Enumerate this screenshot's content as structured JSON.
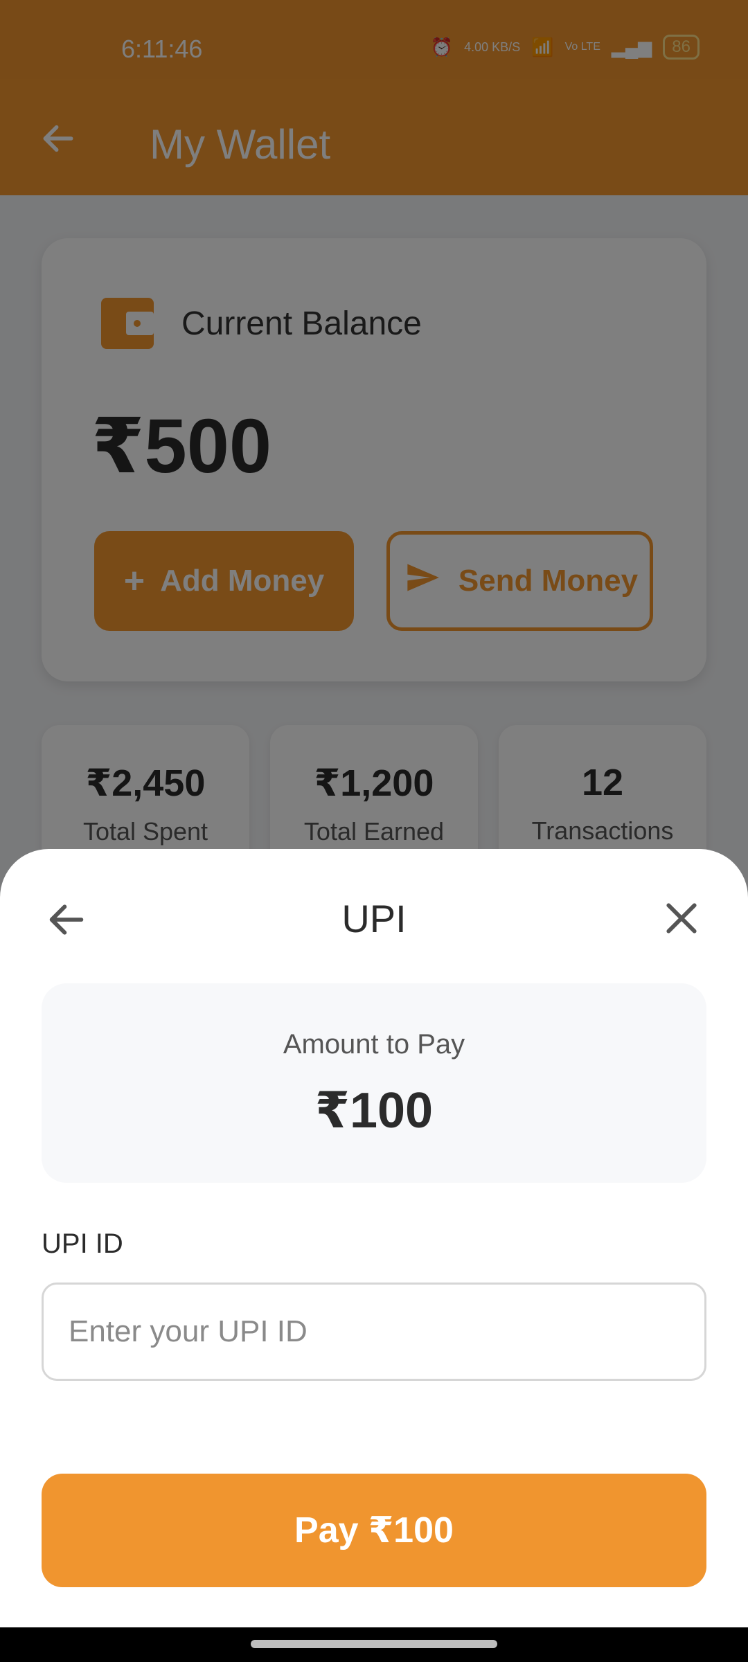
{
  "status_bar": {
    "time": "6:11:46",
    "network_speed": "4.00 KB/S",
    "volte_label": "Vo LTE",
    "battery": "86"
  },
  "app_bar": {
    "title": "My Wallet",
    "back_icon": "arrow-left-icon"
  },
  "balance_card": {
    "label": "Current Balance",
    "amount": "₹500",
    "add_money_label": "Add Money",
    "send_money_label": "Send Money"
  },
  "stats": [
    {
      "value": "₹2,450",
      "label": "Total Spent"
    },
    {
      "value": "₹1,200",
      "label": "Total Earned"
    },
    {
      "value": "12",
      "label": "Transactions"
    }
  ],
  "sheet": {
    "title": "UPI",
    "amount_label": "Amount to Pay",
    "amount_value": "₹100",
    "upi_label": "UPI ID",
    "upi_placeholder": "Enter your UPI ID",
    "upi_value": "",
    "pay_button_label": "Pay ₹100"
  },
  "colors": {
    "accent": "#F0952F",
    "text_dark": "#2B2B2B"
  }
}
